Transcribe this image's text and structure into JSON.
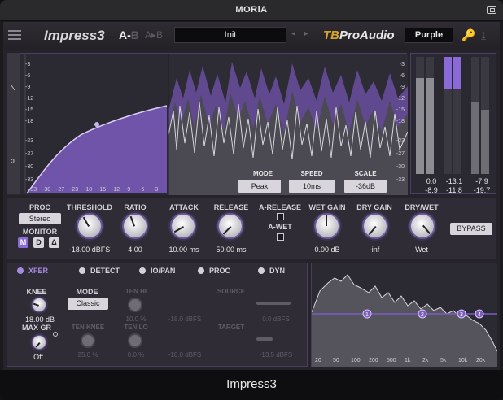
{
  "window": {
    "title": "MORiA"
  },
  "header": {
    "plugin_name": "Impress3",
    "ab_a": "A-",
    "ab_b": "B",
    "ab_copy": "A▸B",
    "preset": "Init",
    "nav_arrows": "◂ ▸",
    "vendor_a": "TB",
    "vendor_b": "ProAudio",
    "theme": "Purple"
  },
  "graph": {
    "left_scale": [
      "-3",
      "-6",
      "-9",
      "-12",
      "-15",
      "-18",
      "-23",
      "-27",
      "-30",
      "-33"
    ],
    "right_scale": [
      "-3",
      "-6",
      "-9",
      "-12",
      "-15",
      "-18",
      "-23",
      "-27",
      "-30",
      "-33"
    ],
    "bottom_scale": [
      "-33",
      "-30",
      "-27",
      "-23",
      "-18",
      "-15",
      "-12",
      "-9",
      "-6",
      "-3"
    ],
    "mode_label": "MODE",
    "mode_value": "Peak",
    "speed_label": "SPEED",
    "speed_value": "10ms",
    "scale_label": "SCALE",
    "scale_value": "-36dB"
  },
  "meters": {
    "in_peak": "0.0",
    "in_rms": "-8.9",
    "gr_peak": "-13.1",
    "gr_rms": "-11.8",
    "out_peak": "-7.9",
    "out_rms": "-19.7",
    "levels": {
      "in_l": 0.82,
      "in_r": 0.82,
      "gr_l": 0.28,
      "gr_r": 0.28,
      "out_l": 0.62,
      "out_r": 0.55
    }
  },
  "controls": {
    "proc_label": "PROC",
    "proc_value": "Stereo",
    "monitor_label": "MONITOR",
    "monitor_m": "M",
    "monitor_d": "D",
    "monitor_delta": "Δ",
    "threshold_label": "THRESHOLD",
    "threshold_value": "-18.00 dBFS",
    "ratio_label": "RATIO",
    "ratio_value": "4.00",
    "attack_label": "ATTACK",
    "attack_value": "10.00 ms",
    "release_label": "RELEASE",
    "release_value": "50.00 ms",
    "arelease_label": "A-RELEASE",
    "awet_label": "A-WET",
    "wetgain_label": "WET GAIN",
    "wetgain_value": "0.00 dB",
    "drygain_label": "DRY GAIN",
    "drygain_value": "-inf",
    "drywet_label": "DRY/WET",
    "drywet_value": "Wet",
    "bypass": "BYPASS"
  },
  "tabs": [
    "XFER",
    "DETECT",
    "IO/PAN",
    "PROC",
    "DYN"
  ],
  "xfer": {
    "knee_label": "KNEE",
    "knee_value": "18.00 dB",
    "maxgr_label": "MAX GR",
    "maxgr_value": "Off",
    "mode_label": "MODE",
    "mode_value": "Classic",
    "tenhi_label": "TEN HI",
    "tenhi_value": "10.0 %",
    "tenknee_label": "TEN KNEE",
    "tenknee_value": "25.0 %",
    "tenlo_label": "TEN LO",
    "tenlo_value": "0.0 %",
    "source_label": "SOURCE",
    "target_label": "TARGET",
    "src_a": "-18.0 dBFS",
    "src_b": "0.0 dBFS",
    "tgt_a": "-18.0 dBFS",
    "tgt_b": "-13.5 dBFS"
  },
  "eq": {
    "nodes": [
      "1",
      "2",
      "3",
      "4"
    ],
    "freq_ticks": [
      "20",
      "50",
      "100",
      "200",
      "500",
      "1k",
      "2k",
      "5k",
      "10k",
      "20k"
    ]
  },
  "footer": {
    "name": "Impress3"
  }
}
